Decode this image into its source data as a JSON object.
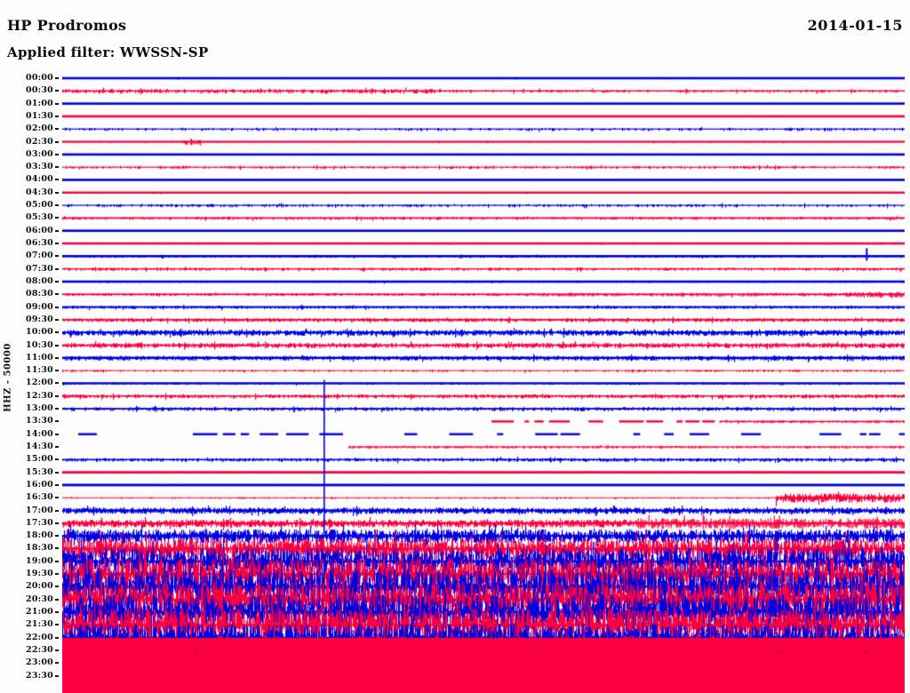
{
  "header": {
    "station": "HP Prodromos",
    "filter": "Applied filter: WWSSN-SP",
    "date": "2014-01-15"
  },
  "axis": {
    "left_label": "HHZ - 50000",
    "row_interval_minutes": 30,
    "first_row": "00:00",
    "last_row": "23:30"
  },
  "chart_data": {
    "type": "helicorder",
    "title": "HP Prodromos",
    "date": "2014-01-15",
    "filter": "WWSSN-SP",
    "channel_scale_label": "HHZ - 50000",
    "colors": {
      "even_trace": "#0000e0",
      "odd_trace": "#fb0140",
      "labels": "#0d0d0d",
      "background": "#fdfdfd"
    },
    "layout": {
      "rows_per_day": 48,
      "minutes_per_row": 30,
      "grid": false,
      "legend": false
    },
    "rows": [
      {
        "time": "00:00",
        "color": "blue",
        "th": 2.6,
        "amp": 0.5,
        "d": 0.08
      },
      {
        "time": "00:30",
        "color": "red",
        "segments": [
          {
            "from": 0,
            "to": 0.45,
            "th": 1.4,
            "amp": 2.2,
            "d": 0.55
          },
          {
            "from": 0.45,
            "to": 1,
            "th": 1.4,
            "amp": 1.6,
            "d": 0.28
          }
        ]
      },
      {
        "time": "01:00",
        "color": "blue",
        "th": 2.6,
        "amp": 0.5,
        "d": 0.08
      },
      {
        "time": "01:30",
        "color": "red",
        "th": 2.6,
        "amp": 0.4,
        "d": 0.05
      },
      {
        "time": "02:00",
        "color": "blue",
        "th": 1.2,
        "amp": 1.5,
        "d": 0.22
      },
      {
        "time": "02:30",
        "color": "red",
        "th": 2.2,
        "amp": 0.7,
        "d": 0.1
      },
      {
        "time": "03:00",
        "color": "blue",
        "th": 2.6,
        "amp": 0.4,
        "d": 0.05
      },
      {
        "time": "03:30",
        "color": "red",
        "th": 1.2,
        "amp": 1.4,
        "d": 0.3
      },
      {
        "time": "04:00",
        "color": "blue",
        "th": 2.6,
        "amp": 0.4,
        "d": 0.05
      },
      {
        "time": "04:30",
        "color": "red",
        "th": 2.4,
        "amp": 0.7,
        "d": 0.1
      },
      {
        "time": "05:00",
        "color": "blue",
        "th": 1.2,
        "amp": 1.5,
        "d": 0.32
      },
      {
        "time": "05:30",
        "color": "red",
        "th": 1.8,
        "amp": 1.4,
        "d": 0.3
      },
      {
        "time": "06:00",
        "color": "blue",
        "th": 2.6,
        "amp": 0.5,
        "d": 0.08
      },
      {
        "time": "06:30",
        "color": "red",
        "th": 2.5,
        "amp": 0.7,
        "d": 0.1
      },
      {
        "time": "07:00",
        "color": "blue",
        "th": 2.6,
        "amp": 1.2,
        "d": 0.3
      },
      {
        "time": "07:30",
        "color": "red",
        "th": 1.5,
        "amp": 1.5,
        "d": 0.38
      },
      {
        "time": "08:00",
        "color": "blue",
        "th": 2.6,
        "amp": 0.8,
        "d": 0.18
      },
      {
        "time": "08:30",
        "color": "red",
        "segments": [
          {
            "from": 0,
            "to": 0.55,
            "th": 1.8,
            "amp": 1.2,
            "d": 0.35
          },
          {
            "from": 0.55,
            "to": 0.93,
            "th": 1.8,
            "amp": 1.8,
            "d": 0.55
          },
          {
            "from": 0.93,
            "to": 1,
            "th": 2,
            "amp": 3,
            "d": 0.9
          }
        ]
      },
      {
        "time": "09:00",
        "color": "blue",
        "th": 2,
        "amp": 1.5,
        "d": 0.4
      },
      {
        "time": "09:30",
        "color": "red",
        "th": 1.8,
        "amp": 2,
        "d": 0.6
      },
      {
        "time": "10:00",
        "color": "blue",
        "th": 2,
        "amp": 3,
        "d": 0.85
      },
      {
        "time": "10:30",
        "color": "red",
        "th": 1.8,
        "amp": 2.6,
        "d": 0.7
      },
      {
        "time": "11:00",
        "color": "blue",
        "th": 2.6,
        "amp": 2.4,
        "d": 0.55
      },
      {
        "time": "11:30",
        "color": "red",
        "th": 1,
        "amp": 1,
        "d": 0.25
      },
      {
        "time": "12:00",
        "color": "blue",
        "th": 2.4,
        "amp": 1,
        "d": 0.3
      },
      {
        "time": "12:30",
        "color": "red",
        "th": 1.6,
        "amp": 2,
        "d": 0.55
      },
      {
        "time": "13:00",
        "color": "blue",
        "th": 1.8,
        "amp": 2,
        "d": 0.5
      },
      {
        "time": "13:30",
        "color": "red",
        "segments": [
          {
            "from": 0.5,
            "to": 0.78,
            "style": "dashes",
            "d": 0.22
          },
          {
            "from": 0.78,
            "to": 1,
            "th": 1.4,
            "amp": 1.4,
            "d": 0.5
          }
        ]
      },
      {
        "time": "14:00",
        "color": "blue",
        "segments": [
          {
            "from": 0,
            "to": 1,
            "style": "dashes",
            "d": 0.09
          }
        ]
      },
      {
        "time": "14:30",
        "color": "red",
        "segments": [
          {
            "from": 0.34,
            "to": 1,
            "th": 1.2,
            "amp": 1.3,
            "d": 0.45
          }
        ]
      },
      {
        "time": "15:00",
        "color": "blue",
        "th": 1.6,
        "amp": 1.8,
        "d": 0.5
      },
      {
        "time": "15:30",
        "color": "red",
        "th": 2.8,
        "amp": 0.4,
        "d": 0.05
      },
      {
        "time": "16:00",
        "color": "blue",
        "th": 2.8,
        "amp": 0.4,
        "d": 0.05
      },
      {
        "time": "16:30",
        "color": "red",
        "segments": [
          {
            "from": 0,
            "to": 0.847,
            "th": 1,
            "amp": 0.8,
            "d": 0.15
          },
          {
            "from": 0.847,
            "to": 1,
            "th": 2,
            "amp": 5,
            "d": 0.95
          }
        ]
      },
      {
        "time": "17:00",
        "color": "blue",
        "th": 2,
        "amp": 3.2,
        "d": 0.92
      },
      {
        "time": "17:30",
        "color": "red",
        "segments": [
          {
            "from": 0,
            "to": 0.68,
            "th": 2,
            "amp": 4,
            "d": 0.92
          },
          {
            "from": 0.68,
            "to": 1,
            "th": 2,
            "amp": 5.5,
            "d": 0.95
          }
        ]
      },
      {
        "time": "18:00",
        "color": "blue",
        "th": 2,
        "amp": 7.5,
        "d": 0.95
      },
      {
        "time": "18:30",
        "color": "red",
        "th": 2,
        "amp": 12,
        "d": 0.95
      },
      {
        "time": "19:00",
        "color": "blue",
        "th": 2,
        "amp": 15,
        "d": 0.95
      },
      {
        "time": "19:30",
        "color": "red",
        "th": 2,
        "amp": 18,
        "d": 0.95
      },
      {
        "time": "20:00",
        "color": "blue",
        "th": 2,
        "amp": 20,
        "d": 0.95
      },
      {
        "time": "20:30",
        "color": "red",
        "th": 2,
        "amp": 20,
        "d": 0.95
      },
      {
        "time": "21:00",
        "color": "blue",
        "th": 2,
        "amp": 20,
        "d": 0.95
      },
      {
        "time": "21:30",
        "color": "red",
        "th": 2,
        "amp": 19,
        "d": 0.95
      },
      {
        "time": "22:00",
        "color": "blue",
        "th": 2,
        "amp": 16,
        "d": 0.95
      },
      {
        "time": "22:30",
        "color": "red",
        "segments": [
          {
            "from": 0,
            "to": 1,
            "style": "fill",
            "up": 14,
            "down": 30
          },
          {
            "from": 0,
            "to": 1,
            "th": 0,
            "amp": 18,
            "d": 0.9
          }
        ]
      },
      {
        "time": "23:00",
        "color": "blue",
        "th": 2,
        "amp": 8,
        "d": 0.7
      },
      {
        "time": "23:30",
        "color": "red",
        "segments": [
          {
            "from": 0,
            "to": 1,
            "style": "fill",
            "up": 26,
            "down": 20
          }
        ]
      }
    ],
    "events": [
      {
        "time": "02:30",
        "x": 0.153,
        "up": 3.5,
        "down": 3.5,
        "width": 10,
        "note": "small local burst"
      },
      {
        "time": "07:00",
        "x": 0.955,
        "up": 9,
        "down": 5,
        "width": 2,
        "note": "single spike"
      },
      {
        "time": "12:00",
        "x": 0.311,
        "up": 4,
        "down": 170,
        "width": 1.6,
        "note": "large clipped spike extending down across rows"
      }
    ]
  }
}
